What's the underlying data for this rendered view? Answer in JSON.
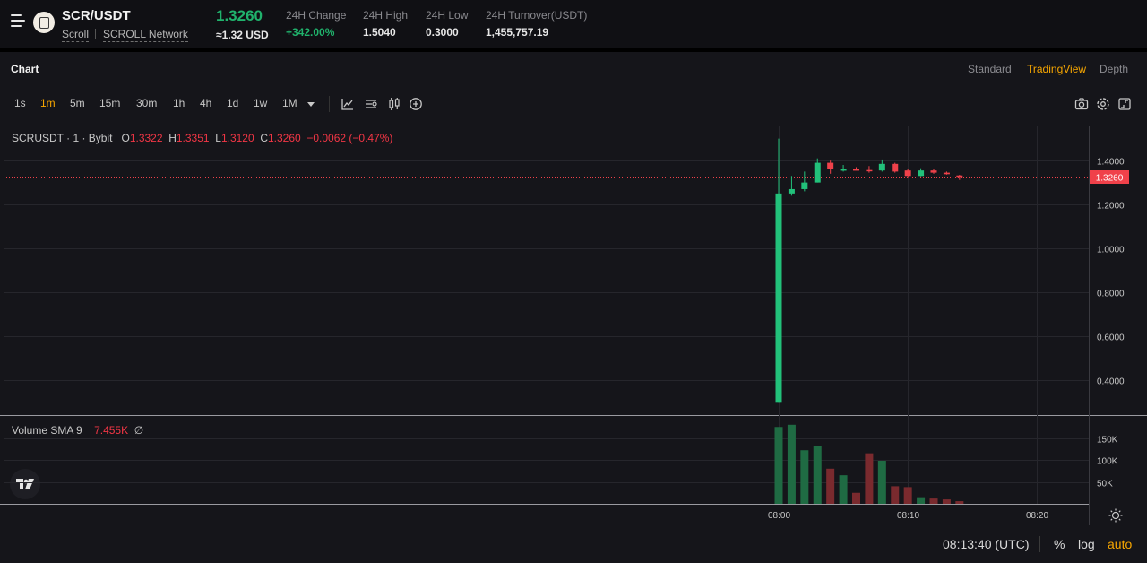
{
  "header": {
    "pair": "SCR/USDT",
    "chain_name": "Scroll",
    "network": "SCROLL Network",
    "last_price": "1.3260",
    "usd_price": "≈1.32 USD",
    "stats": [
      {
        "label": "24H Change",
        "value": "+342.00%"
      },
      {
        "label": "24H High",
        "value": "1.5040"
      },
      {
        "label": "24H Low",
        "value": "0.3000"
      },
      {
        "label": "24H Turnover(USDT)",
        "value": "1,455,757.19"
      }
    ]
  },
  "chart_panel": {
    "title": "Chart",
    "views": [
      "Standard",
      "TradingView",
      "Depth"
    ],
    "active_view": "TradingView",
    "intervals": [
      "1s",
      "1m",
      "5m",
      "15m",
      "30m",
      "1h",
      "4h",
      "1d",
      "1w",
      "1M"
    ],
    "active_interval": "1m"
  },
  "legend": {
    "symbol": "SCRUSDT · 1 · Bybit",
    "o_label": "O",
    "o": "1.3322",
    "h_label": "H",
    "h": "1.3351",
    "l_label": "L",
    "l": "1.3120",
    "c_label": "C",
    "c": "1.3260",
    "change": "−0.0062 (−0.47%)"
  },
  "volume_legend": {
    "label": "Volume SMA 9",
    "value": "7.455K",
    "symbol": "∅"
  },
  "footer": {
    "time": "08:13:40 (UTC)",
    "percent": "%",
    "log": "log",
    "auto": "auto"
  },
  "colors": {
    "up": "#22c17a",
    "down": "#f0414a",
    "up_volume": "#1f6b43",
    "down_volume": "#7a2a2e",
    "accent": "#f7a600"
  },
  "chart_data": {
    "type": "candlestick",
    "price_axis": {
      "ticks": [
        "1.4000",
        "1.2000",
        "1.0000",
        "0.8000",
        "0.6000",
        "0.4000"
      ],
      "ylim": [
        0.24,
        1.56
      ]
    },
    "current_price": "1.3260",
    "current_price_value": 1.326,
    "time_axis": {
      "ticks": [
        "08:00",
        "08:10",
        "08:20"
      ],
      "start": "07:00",
      "end": "08:24"
    },
    "candles": [
      {
        "t": "08:00",
        "o": 0.3,
        "h": 1.5,
        "l": 0.3,
        "c": 1.25
      },
      {
        "t": "08:01",
        "o": 1.25,
        "h": 1.33,
        "l": 1.24,
        "c": 1.27
      },
      {
        "t": "08:02",
        "o": 1.27,
        "h": 1.35,
        "l": 1.26,
        "c": 1.3
      },
      {
        "t": "08:03",
        "o": 1.3,
        "h": 1.41,
        "l": 1.3,
        "c": 1.39
      },
      {
        "t": "08:04",
        "o": 1.39,
        "h": 1.4,
        "l": 1.34,
        "c": 1.36
      },
      {
        "t": "08:05",
        "o": 1.36,
        "h": 1.38,
        "l": 1.35,
        "c": 1.36
      },
      {
        "t": "08:06",
        "o": 1.36,
        "h": 1.37,
        "l": 1.355,
        "c": 1.357
      },
      {
        "t": "08:07",
        "o": 1.357,
        "h": 1.375,
        "l": 1.345,
        "c": 1.355
      },
      {
        "t": "08:08",
        "o": 1.355,
        "h": 1.405,
        "l": 1.35,
        "c": 1.385
      },
      {
        "t": "08:09",
        "o": 1.385,
        "h": 1.39,
        "l": 1.345,
        "c": 1.35
      },
      {
        "t": "08:10",
        "o": 1.355,
        "h": 1.36,
        "l": 1.325,
        "c": 1.33
      },
      {
        "t": "08:11",
        "o": 1.33,
        "h": 1.365,
        "l": 1.328,
        "c": 1.355
      },
      {
        "t": "08:12",
        "o": 1.355,
        "h": 1.36,
        "l": 1.34,
        "c": 1.345
      },
      {
        "t": "08:13",
        "o": 1.345,
        "h": 1.35,
        "l": 1.336,
        "c": 1.338
      },
      {
        "t": "08:14",
        "o": 1.3322,
        "h": 1.3351,
        "l": 1.312,
        "c": 1.326
      }
    ],
    "volume_axis": {
      "ticks": [
        "150K",
        "100K",
        "50K"
      ],
      "ylim": [
        0,
        200
      ]
    },
    "volume_k": [
      175,
      180,
      122,
      132,
      80,
      65,
      25,
      115,
      98,
      40,
      38,
      15,
      12,
      10,
      6
    ]
  }
}
